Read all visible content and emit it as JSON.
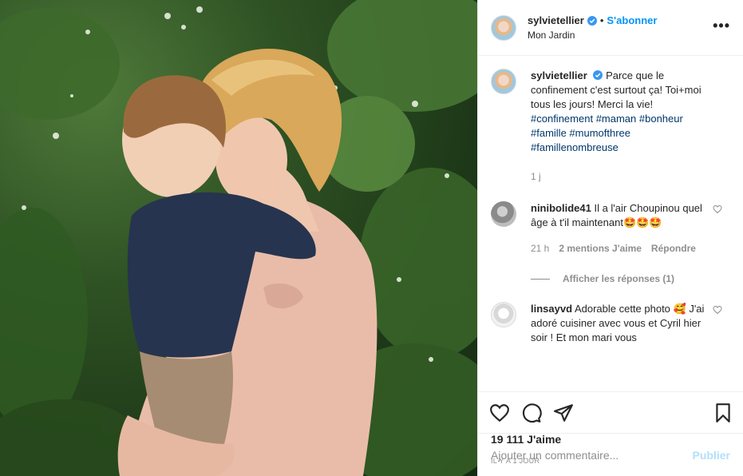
{
  "header": {
    "username": "sylvietellier",
    "dot": "•",
    "follow_label": "S'abonner",
    "location": "Mon Jardin",
    "more_label": "•••"
  },
  "caption": {
    "username": "sylvietellier",
    "text": "Parce que le confinement c'est surtout ça! Toi+moi tous les jours! Merci la vie!",
    "hashtags": [
      "#confinement",
      "#maman",
      "#bonheur",
      "#famille",
      "#mumofthree",
      "#famillenombreuse"
    ],
    "time": "1 j"
  },
  "comments": [
    {
      "username": "ninibolide41",
      "text": "Il a l'air Choupinou quel âge à t'il maintenant🤩🤩🤩",
      "time": "21 h",
      "likes": "2 mentions J'aime",
      "reply_label": "Répondre",
      "view_replies": "Afficher les réponses (1)"
    },
    {
      "username": "linsayvd",
      "text": "Adorable cette photo 🥰 J'ai adoré cuisiner avec vous et Cyril hier soir ! Et mon mari vous"
    }
  ],
  "footer": {
    "likes": "19 111 J'aime",
    "date": "IL Y A 1 JOUR",
    "comment_placeholder": "Ajouter un commentaire...",
    "post_label": "Publier"
  },
  "icons": {
    "like": "heart-icon",
    "comment": "comment-icon",
    "share": "share-icon",
    "save": "bookmark-icon",
    "verified": "verified-badge-icon"
  },
  "colors": {
    "accent": "#0095f6",
    "hashtag": "#00376b",
    "muted": "#8e8e8e",
    "post_disabled": "#b2dffc"
  }
}
